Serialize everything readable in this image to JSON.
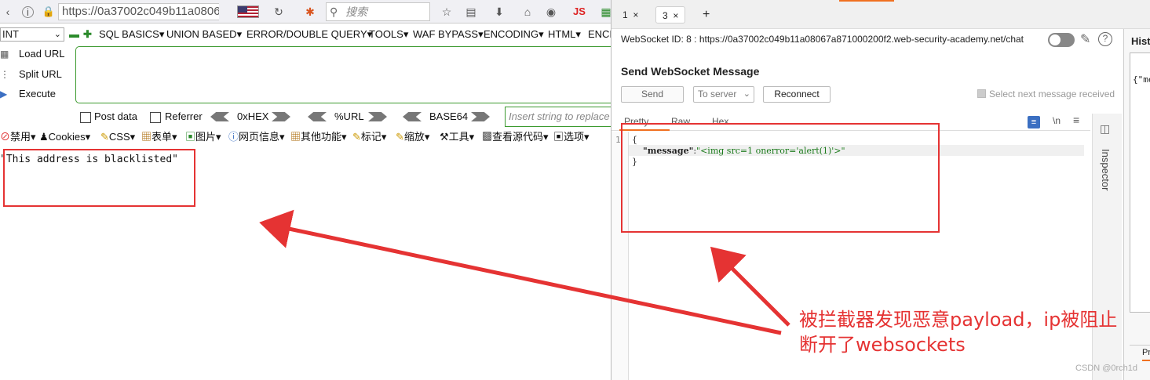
{
  "browser": {
    "url": "https://0a37002c049b11a0806",
    "search_placeholder": "搜索",
    "js_badge": "JS"
  },
  "hackbar": {
    "select_value": "INT",
    "menu": [
      "SQL BASICS",
      "UNION BASED",
      "ERROR/DOUBLE QUERY",
      "TOOLS",
      "WAF BYPASS",
      "ENCODING",
      "HTML",
      "ENCR"
    ],
    "actions": [
      "Load URL",
      "Split URL",
      "Execute"
    ],
    "post_data": "Post data",
    "referrer": "Referrer",
    "encoders": [
      "0xHEX",
      "%URL",
      "BASE64"
    ],
    "insert_placeholder": "Insert string to replace"
  },
  "cn_toolbar": [
    "禁用",
    "Cookies",
    "CSS",
    "表单",
    "图片",
    "网页信息",
    "其他功能",
    "标记",
    "缩放",
    "工具",
    "查看源代码",
    "选项"
  ],
  "page": {
    "content": "\"This address is blacklisted\""
  },
  "burp": {
    "tabs": [
      {
        "label": "1",
        "close": "×"
      },
      {
        "label": "3",
        "close": "×"
      }
    ],
    "add_tab": "+",
    "ws_id_line": "WebSocket ID: 8 : https://0a37002c049b11a08067a871000200f2.web-security-academy.net/chat",
    "send_title": "Send WebSocket Message",
    "send_label": "Send",
    "direction": "To server",
    "reconnect_label": "Reconnect",
    "select_next": "Select next message received",
    "editor_tabs": [
      "Pretty",
      "Raw",
      "Hex"
    ],
    "newline_toggle": "\\n",
    "menu_glyph": "≡",
    "code": {
      "line1": "{",
      "key": "\"message\"",
      "colon": ":",
      "value": "\"<img src=1 onerror='alert(1)'>\"",
      "line3": "}"
    },
    "line_numbers": [
      "1"
    ],
    "inspector_label": "Inspector",
    "history_title": "Hist",
    "history_snippet": "{\"me",
    "history_bottom": "Pr"
  },
  "annotation": {
    "line1": "被拦截器发现恶意payload，ip被阻止",
    "line2": "断开了websockets"
  },
  "watermark": "CSDN @0rch1d",
  "colors": {
    "annotation_red": "#e53333",
    "accent_orange": "#f07020",
    "hackbar_green": "#3c9a2f"
  }
}
